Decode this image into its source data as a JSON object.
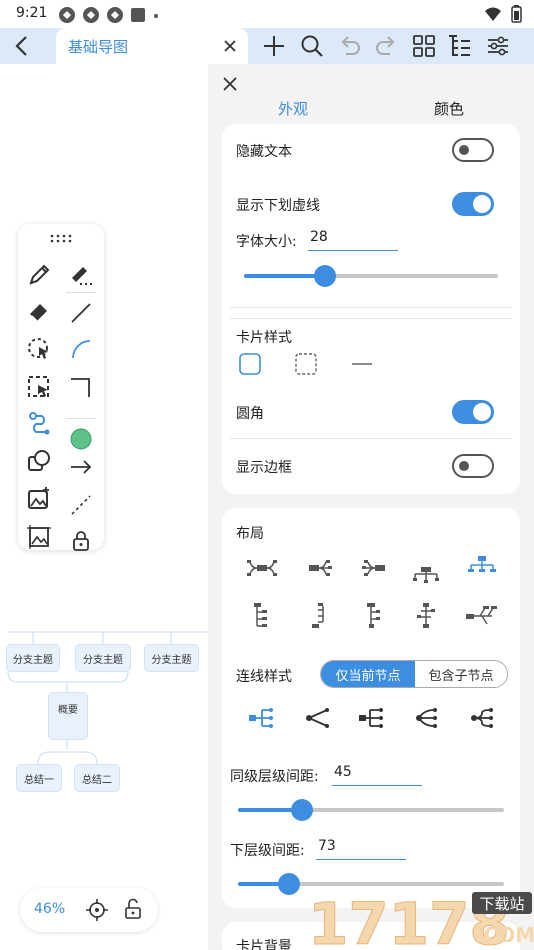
{
  "status_bar": {
    "time": "9:21"
  },
  "app_bar": {
    "tab_title": "基础导图"
  },
  "canvas": {
    "nodes": {
      "branch1": "分支主题",
      "branch2": "分支主题",
      "branch3": "分支主题",
      "summary": "概要",
      "conclusion1": "总结一",
      "conclusion2": "总结二"
    },
    "zoom": "46%"
  },
  "panel": {
    "tabs": {
      "appearance": "外观",
      "color": "颜色"
    },
    "hide_text": {
      "label": "隐藏文本",
      "checked": false
    },
    "show_underline": {
      "label": "显示下划虚线",
      "checked": true
    },
    "font_size": {
      "label": "字体大小:",
      "value": "28",
      "fraction": 0.32
    },
    "card_style": {
      "label": "卡片样式"
    },
    "rounded_corner": {
      "label": "圆角",
      "checked": true
    },
    "show_border": {
      "label": "显示边框",
      "checked": false
    },
    "layout": {
      "label": "布局",
      "selected_index": 4
    },
    "line_style": {
      "label": "连线样式",
      "options": [
        "仅当前节点",
        "包含子节点"
      ],
      "selected": "仅当前节点",
      "selected_icon_index": 0
    },
    "sibling_spacing": {
      "label": "同级层级间距:",
      "value": "45",
      "fraction": 0.24
    },
    "child_spacing": {
      "label": "下层级间距:",
      "value": "73",
      "fraction": 0.19
    },
    "card_background": {
      "label": "卡片背景"
    }
  },
  "watermark": {
    "text": "17178",
    "badge": "下载站",
    "domain": ".COM"
  },
  "colors": {
    "accent": "#3d8de0",
    "tab_bar": "#dbe9f8",
    "node_fill": "#e9f2fc",
    "green_dot": "#5cc28a"
  }
}
